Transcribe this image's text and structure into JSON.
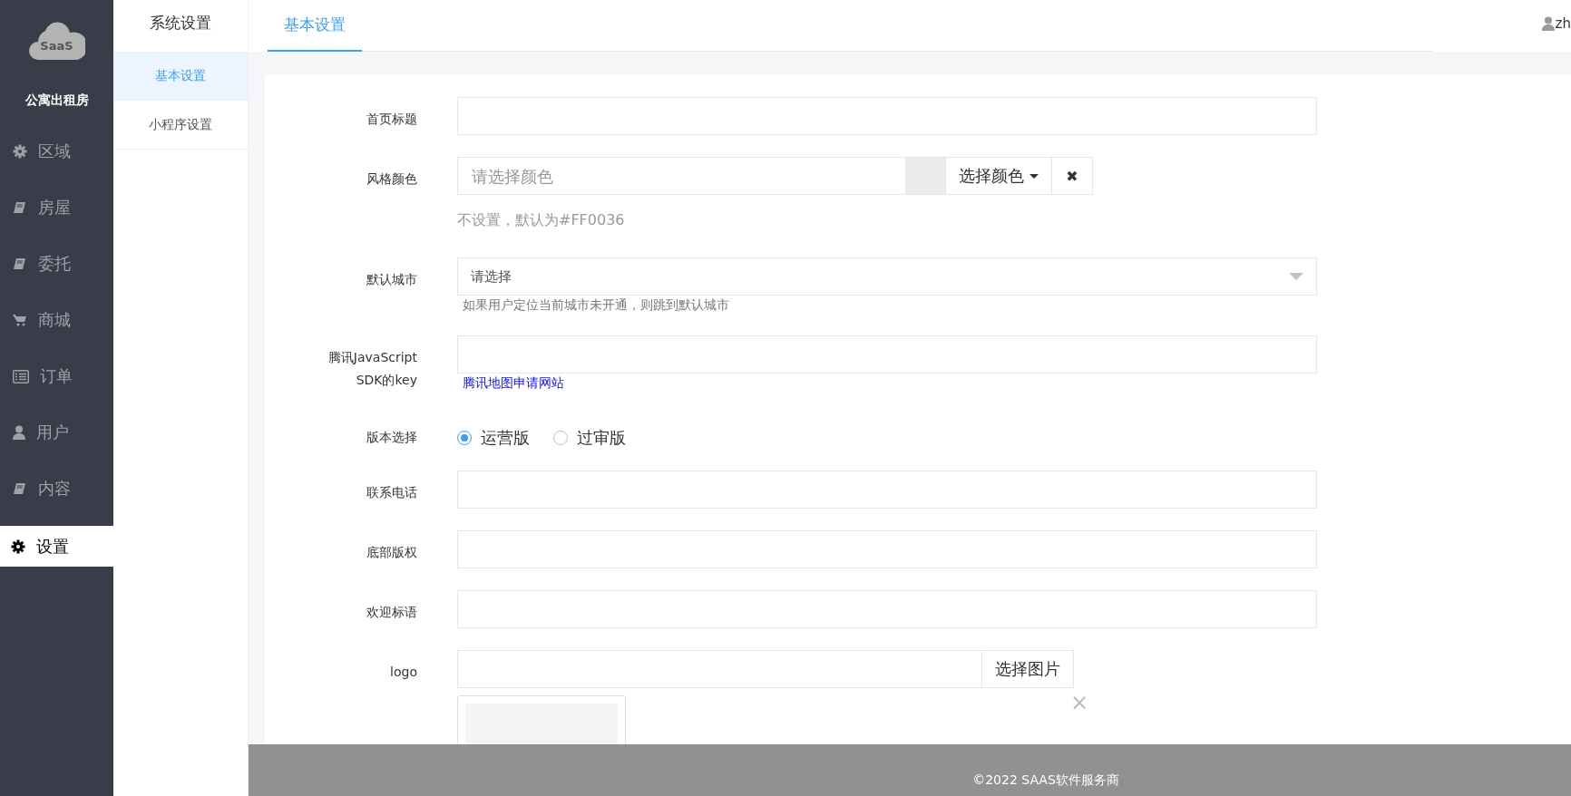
{
  "sidebar": {
    "brand": "SaaS",
    "title": "公寓出租房",
    "items": [
      {
        "label": "区域",
        "kind": "gear",
        "selected": false
      },
      {
        "label": "房屋",
        "kind": "book",
        "selected": false
      },
      {
        "label": "委托",
        "kind": "book",
        "selected": false
      },
      {
        "label": "商城",
        "kind": "cart",
        "selected": false
      },
      {
        "label": "订单",
        "kind": "list",
        "selected": false
      },
      {
        "label": "用户",
        "kind": "user",
        "selected": false
      },
      {
        "label": "内容",
        "kind": "book",
        "selected": false
      },
      {
        "label": "设置",
        "kind": "gear",
        "selected": true
      }
    ]
  },
  "submenu": {
    "title": "系统设置",
    "items": [
      {
        "label": "基本设置",
        "selected": true
      },
      {
        "label": "小程序设置",
        "selected": false
      }
    ]
  },
  "header": {
    "tabs": [
      {
        "label": "基本设置",
        "selected": true
      }
    ],
    "user": "zh"
  },
  "form": {
    "rows": [
      {
        "kind": "text",
        "label": "首页标题"
      },
      {
        "kind": "color",
        "label": "风格颜色",
        "placeholder": "请选择颜色",
        "button": "选择颜色",
        "clear": "✖",
        "hint": "不设置，默认为#FF0036"
      },
      {
        "kind": "select",
        "label": "默认城市",
        "value": "请选择",
        "hint": "如果用户定位当前城市未开通，则跳到默认城市"
      },
      {
        "kind": "text",
        "label": "腾讯JavaScript SDK的key",
        "link": "腾讯地图申请网站"
      },
      {
        "kind": "radio",
        "label": "版本选择",
        "options": [
          {
            "label": "运营版",
            "selected": true
          },
          {
            "label": "过审版",
            "selected": false
          }
        ]
      },
      {
        "kind": "text",
        "label": "联系电话"
      },
      {
        "kind": "text",
        "label": "底部版权"
      },
      {
        "kind": "text",
        "label": "欢迎标语"
      },
      {
        "kind": "image",
        "label": "logo",
        "button": "选择图片",
        "remove": "×"
      }
    ]
  },
  "footer": {
    "text": "©2022 SAAS软件服务商"
  }
}
